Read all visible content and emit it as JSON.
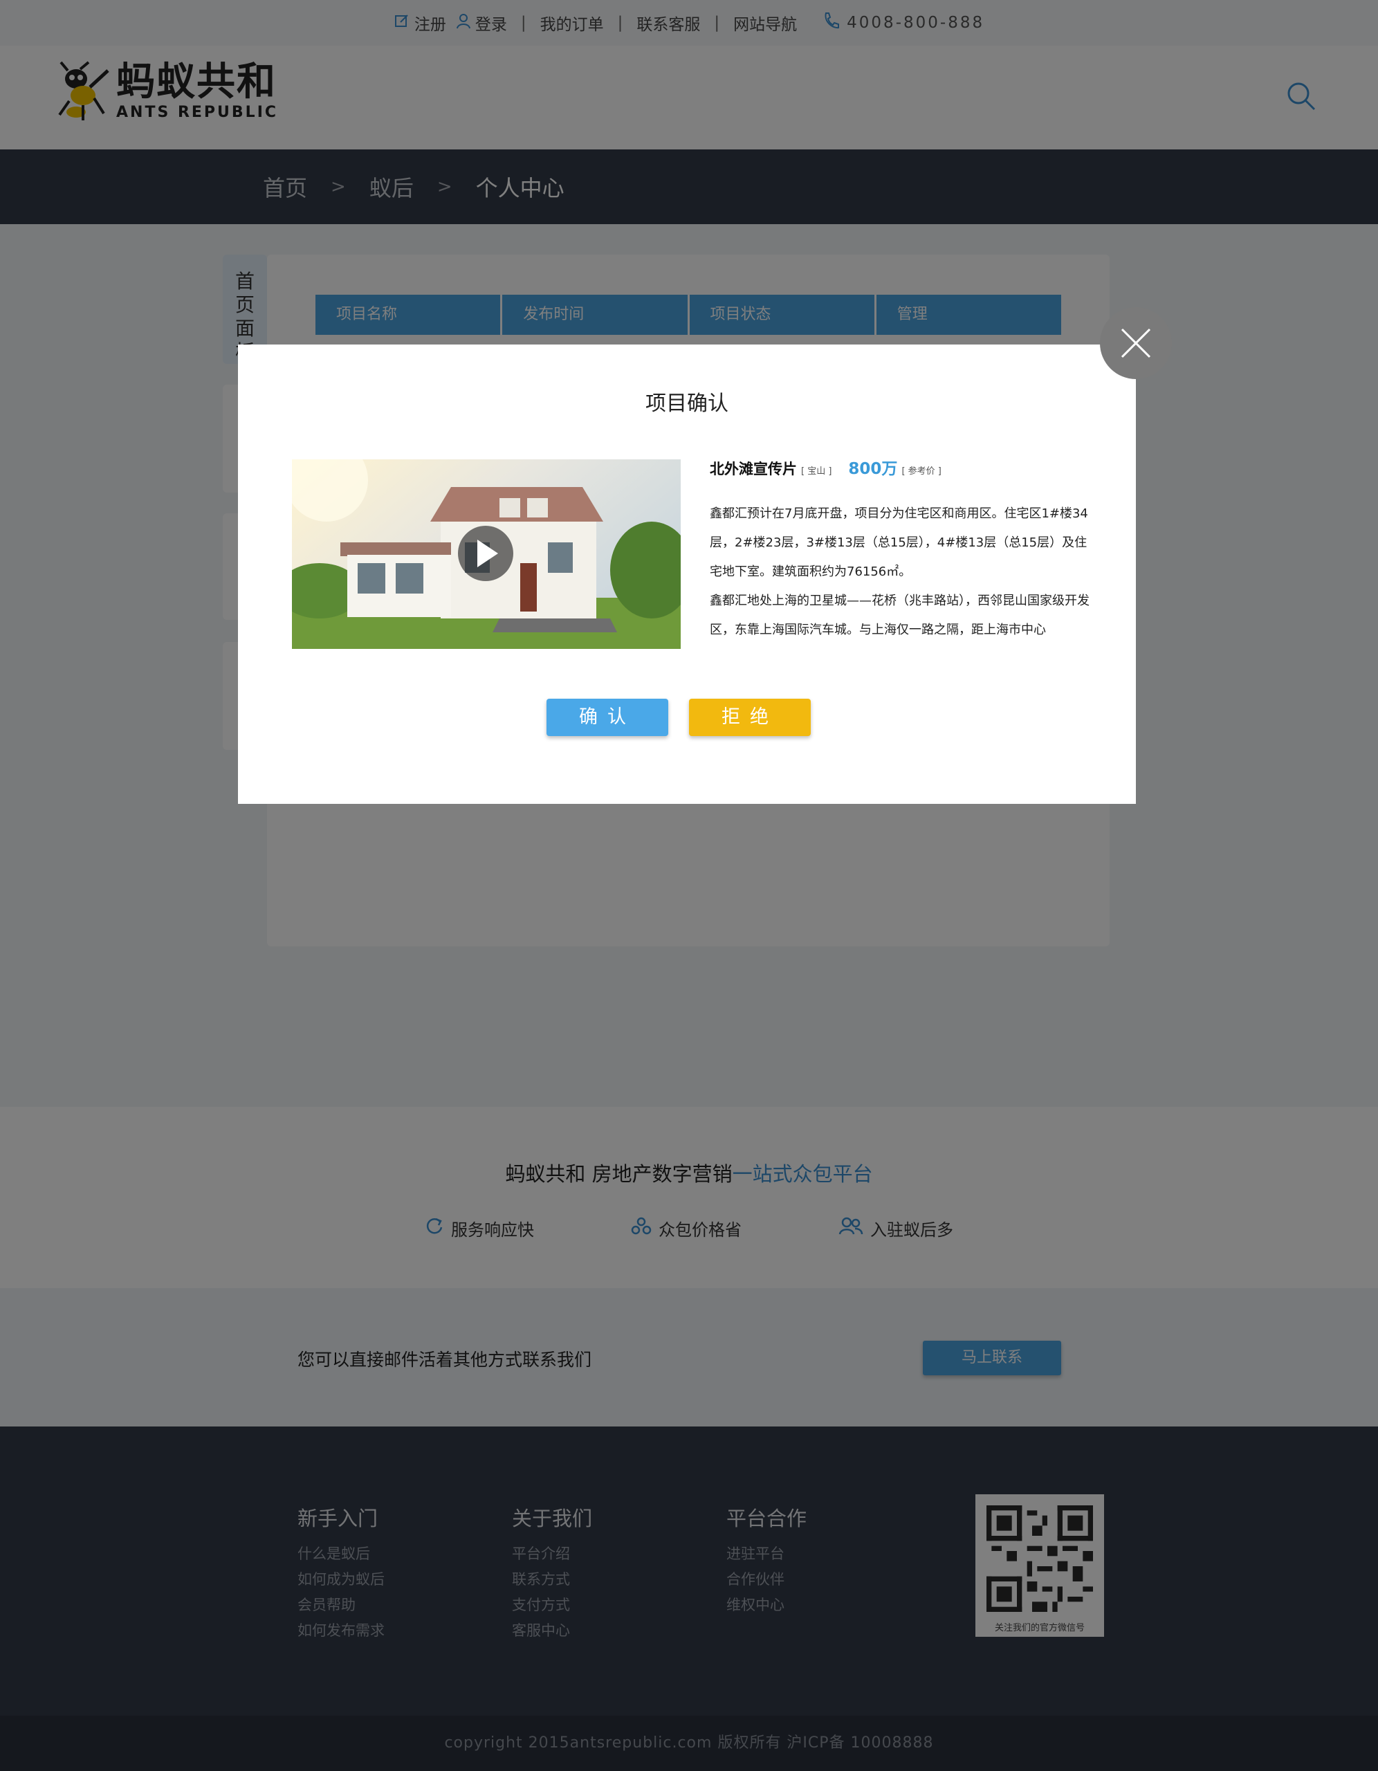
{
  "topbar": {
    "register": "注册",
    "login": "登录",
    "sep": "|",
    "orders": "我的订单",
    "service": "联系客服",
    "sitenav": "网站导航",
    "phone": "4008-800-888"
  },
  "header": {
    "logo_cn": "蚂蚁共和",
    "logo_en": "ANTS REPUBLIC"
  },
  "breadcrumb": {
    "home": "首页",
    "sep": ">",
    "level2": "蚁后",
    "current": "个人中心"
  },
  "sidebar": {
    "first_tab": "首页面板"
  },
  "table": {
    "headers": [
      "项目名称",
      "发布时间",
      "项目状态",
      "管理"
    ]
  },
  "modal": {
    "title": "项目确认",
    "project_name": "北外滩宣传片",
    "district_tag": "[ 宝山 ]",
    "price": "800万",
    "price_tag": "[ 参考价 ]",
    "description_1": "鑫都汇预计在7月底开盘，项目分为住宅区和商用区。住宅区1#楼34层，2#楼23层，3#楼13层（总15层），4#楼13层（总15层）及住宅地下室。建筑面积约为76156㎡。",
    "description_2": "鑫都汇地处上海的卫星城——花桥（兆丰路站），西邻昆山国家级开发区，东靠上海国际汽车城。与上海仅一路之隔，距上海市中心",
    "confirm": "确认",
    "reject": "拒绝"
  },
  "promo": {
    "title_main": "蚂蚁共和 房地产数字营销",
    "title_highlight": "一站式众包平台",
    "features": [
      "服务响应快",
      "众包价格省",
      "入驻蚁后多"
    ]
  },
  "contact": {
    "text": "您可以直接邮件活着其他方式联系我们",
    "button": "马上联系"
  },
  "footer": {
    "columns": [
      {
        "title": "新手入门",
        "links": [
          "什么是蚁后",
          "如何成为蚁后",
          "会员帮助",
          "如何发布需求"
        ]
      },
      {
        "title": "关于我们",
        "links": [
          "平台介绍",
          "联系方式",
          "支付方式",
          "客服中心"
        ]
      },
      {
        "title": "平台合作",
        "links": [
          "进驻平台",
          "合作伙伴",
          "维权中心"
        ]
      }
    ],
    "qr_caption": "关注我们的官方微信号",
    "copyright": "copyright 2015antsrepublic.com 版权所有 沪ICP备 10008888"
  },
  "colors": {
    "accent": "#4aa3df",
    "dark_band": "#323a48",
    "reject": "#f2b90f"
  }
}
